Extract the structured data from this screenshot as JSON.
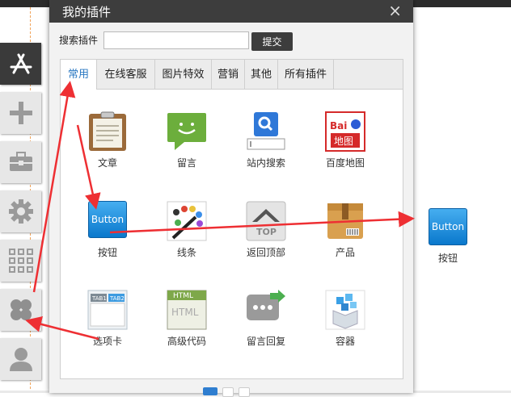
{
  "dialog": {
    "title": "我的插件",
    "close": "×",
    "search": {
      "label": "搜索插件",
      "value": "",
      "placeholder": "",
      "submit": "提交"
    },
    "tabs": [
      {
        "label": "常用",
        "active": true
      },
      {
        "label": "在线客服",
        "active": false
      },
      {
        "label": "图片特效",
        "active": false
      },
      {
        "label": "营销",
        "active": false
      },
      {
        "label": "其他",
        "active": false
      },
      {
        "label": "所有插件",
        "active": false
      }
    ],
    "plugins": [
      {
        "label": "文章",
        "icon": "clipboard-icon"
      },
      {
        "label": "留言",
        "icon": "chat-bubble-icon"
      },
      {
        "label": "站内搜索",
        "icon": "search-icon"
      },
      {
        "label": "百度地图",
        "icon": "baidu-map-icon",
        "icon_text": "Bai地图"
      },
      {
        "label": "按钮",
        "icon": "button-icon",
        "icon_text": "Button"
      },
      {
        "label": "线条",
        "icon": "line-palette-icon"
      },
      {
        "label": "返回顶部",
        "icon": "back-to-top-icon",
        "icon_text": "TOP"
      },
      {
        "label": "产品",
        "icon": "product-box-icon"
      },
      {
        "label": "选项卡",
        "icon": "tabs-icon",
        "icon_text": "TAB1 TAB2"
      },
      {
        "label": "高级代码",
        "icon": "html-code-icon",
        "icon_text": "HTML"
      },
      {
        "label": "留言回复",
        "icon": "message-reply-icon"
      },
      {
        "label": "容器",
        "icon": "container-icon"
      }
    ]
  },
  "toolbar": {
    "items": [
      {
        "icon": "app-store-icon",
        "active": true
      },
      {
        "icon": "plus-icon",
        "active": false
      },
      {
        "icon": "toolbox-icon",
        "active": false
      },
      {
        "icon": "gear-icon",
        "active": false
      },
      {
        "icon": "grid-icon",
        "active": false
      },
      {
        "icon": "plugin-clover-icon",
        "active": false
      },
      {
        "icon": "user-icon",
        "active": false
      }
    ]
  },
  "result": {
    "icon_text": "Button",
    "label": "按钮"
  },
  "colors": {
    "accent": "#2a78c2",
    "header": "#3d3d3d",
    "annotation": "#ee2f33"
  }
}
